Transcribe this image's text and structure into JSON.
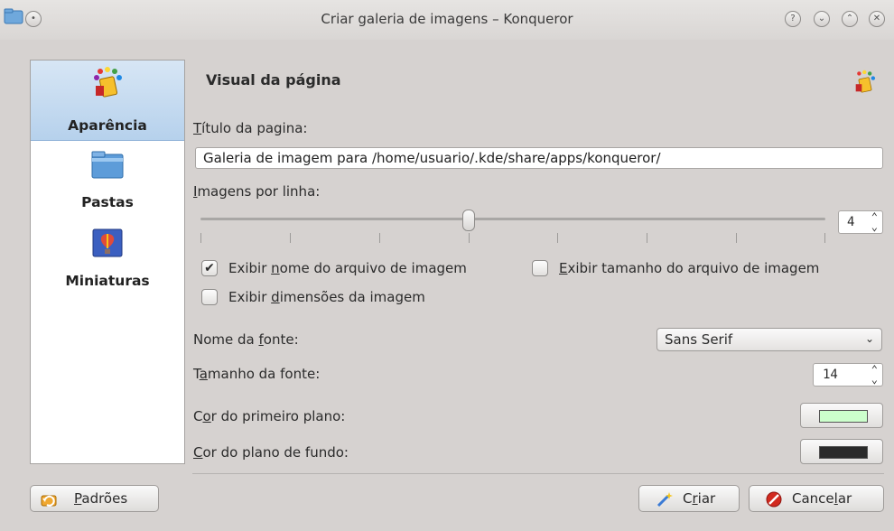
{
  "window": {
    "title": "Criar galeria de imagens – Konqueror",
    "help_label": "?",
    "minimize_label": "⌄",
    "maximize_label": "⌃",
    "close_label": "✕"
  },
  "sidebar": {
    "items": [
      {
        "label": "Aparência",
        "icon": "paint-bucket-icon",
        "active": true
      },
      {
        "label": "Pastas",
        "icon": "folder-icon",
        "active": false
      },
      {
        "label": "Miniaturas",
        "icon": "picture-icon",
        "active": false
      }
    ]
  },
  "page": {
    "heading": "Visual da página",
    "title_label_first": "T",
    "title_label_rest": "ítulo da pagina:",
    "title_value": "Galeria de imagem para /home/usuario/.kde/share/apps/konqueror/",
    "per_row_label_first": "I",
    "per_row_label_rest": "magens por linha:",
    "per_row_value": "4",
    "per_row_min": 1,
    "per_row_max": 8,
    "show_name_pre": "Exibir ",
    "show_name_ul": "n",
    "show_name_post": "ome do arquivo de imagem",
    "show_name_checked": true,
    "show_name_check_glyph": "✔",
    "show_size_ul": "E",
    "show_size_post": "xibir tamanho do arquivo de imagem",
    "show_size_checked": false,
    "show_dim_pre": "Exibir ",
    "show_dim_ul": "d",
    "show_dim_post": "imensões da imagem",
    "show_dim_checked": false,
    "font_name_pre": "Nome da ",
    "font_name_ul": "f",
    "font_name_post": "onte:",
    "font_name_value": "Sans Serif",
    "font_size_pre": "T",
    "font_size_ul": "a",
    "font_size_post": "manho da fonte:",
    "font_size_value": "14",
    "fg_pre": "C",
    "fg_ul": "o",
    "fg_post": "r do primeiro plano:",
    "fg_color": "#ccffcc",
    "bg_ul": "C",
    "bg_post": "or do plano de fundo:",
    "bg_color": "#2a2a2a"
  },
  "buttons": {
    "defaults_ul": "P",
    "defaults_post": "adrões",
    "create_pre": "C",
    "create_ul": "r",
    "create_post": "iar",
    "cancel_pre": "Cance",
    "cancel_ul": "l",
    "cancel_post": "ar"
  },
  "colors": {
    "accent": "#b6d1ec",
    "cancel_icon": "#d22a1f"
  }
}
